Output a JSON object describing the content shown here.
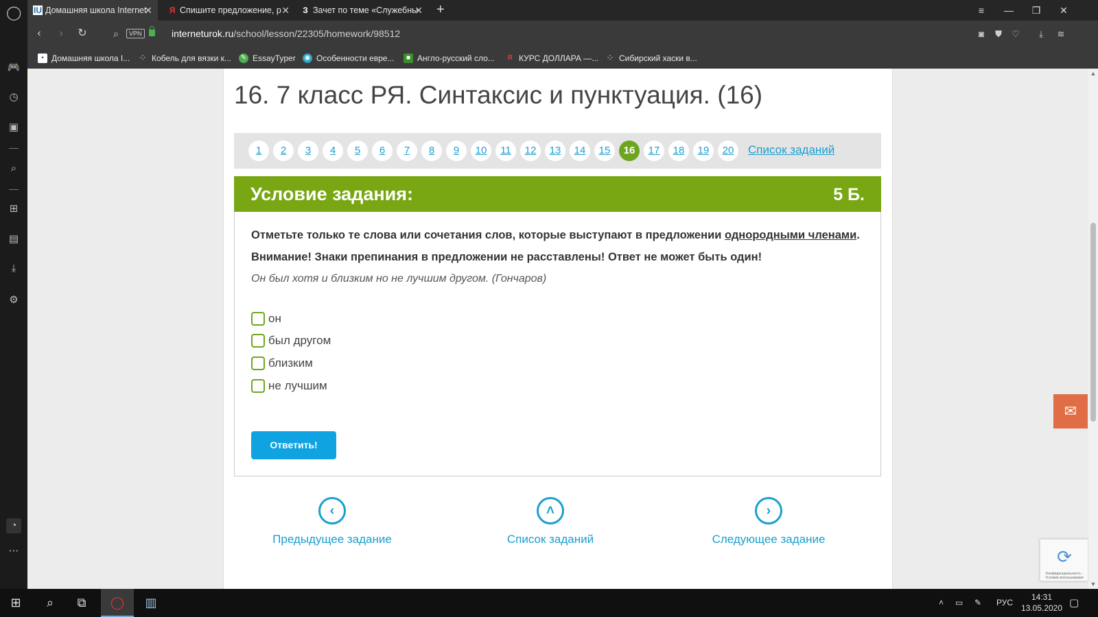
{
  "browser": {
    "tabs": [
      {
        "label": "Домашняя школа Internet",
        "favicon": "IU"
      },
      {
        "label": "Спишите предложение, р",
        "favicon": "Я"
      },
      {
        "label": "Зачет по теме «Служебны",
        "favicon": "З"
      }
    ],
    "new_tab": "+",
    "url_domain": "interneturok.ru",
    "url_path": "/school/lesson/22305/homework/98512",
    "vpn_label": "VPN",
    "bookmarks": [
      "Домашняя школа I...",
      "Кобель для вязки к...",
      "EssayTyper",
      "Особенности евре...",
      "Англо-русский сло...",
      "КУРС ДОЛЛАРА —...",
      "Сибирский хаски в..."
    ]
  },
  "page": {
    "title": "16. 7 класс РЯ. Синтаксис и пунктуация. (16)",
    "task_numbers": [
      "1",
      "2",
      "3",
      "4",
      "5",
      "6",
      "7",
      "8",
      "9",
      "10",
      "11",
      "12",
      "13",
      "14",
      "15",
      "16",
      "17",
      "18",
      "19",
      "20"
    ],
    "current_task": "16",
    "task_list_link": "Список заданий",
    "condition_heading": "Условие задания:",
    "points": "5 Б.",
    "question_part1": "Отметьте только те слова или сочетания слов, которые выступают в предложении ",
    "question_underlined": "однородными членами",
    "question_part2": ".",
    "question_note": "Внимание! Знаки препинания в предложении не расставлены! Ответ не может быть один!",
    "sentence": "Он был хотя и близким но не лучшим другом. (Гончаров)",
    "options": [
      "он",
      "был другом",
      "близким",
      "не лучшим"
    ],
    "answer_button": "Ответить!",
    "prev_task": "Предыдущее задание",
    "list_task": "Список заданий",
    "next_task": "Следующее задание",
    "recaptcha_text": "Конфиденциальность - Условия использования"
  },
  "taskbar": {
    "language": "РУС",
    "time": "14:31",
    "date": "13.05.2020"
  },
  "colors": {
    "accent_green": "#78a713",
    "link_blue": "#1a9fcf",
    "button_blue": "#0fa3e1",
    "chat_orange": "#e06d45"
  }
}
